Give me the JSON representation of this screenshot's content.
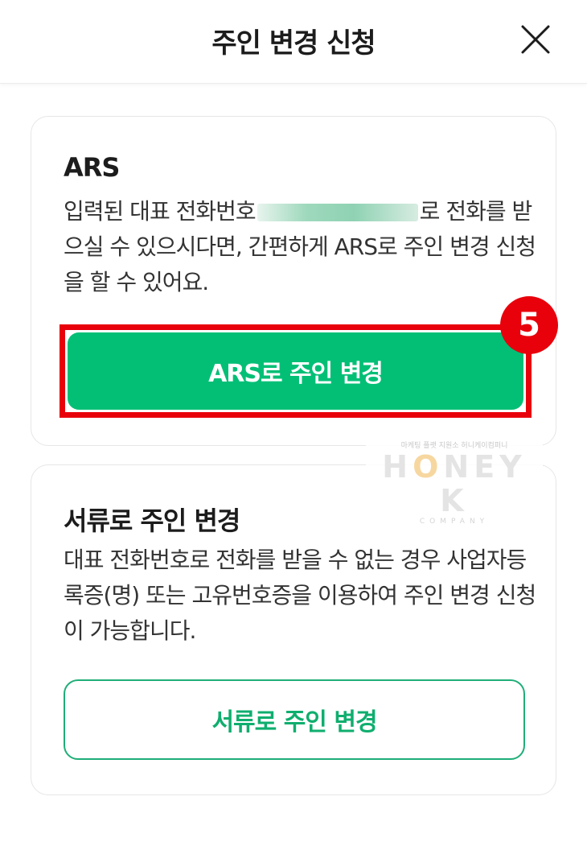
{
  "header": {
    "title": "주인 변경 신청",
    "close_icon": "close-icon"
  },
  "ars_card": {
    "title": "ARS",
    "description_before": "입력된 대표 전화번호",
    "description_after": "로 전화를 받으실 수 있으시다면, 간편하게 ARS로 주인 변경 신청을 할 수 있어요.",
    "button_label": "ARS로 주인 변경",
    "step_badge": "5",
    "highlight_color": "#e8000b",
    "button_color": "#03bf76"
  },
  "doc_card": {
    "title": "서류로 주인 변경",
    "description": "대표 전화번호로 전화를 받을 수 없는 경우 사업자등록증(명) 또는 고유번호증을 이용하여 주인 변경 신청이 가능합니다.",
    "button_label": "서류로 주인 변경"
  },
  "watermark": {
    "tagline": "마케팅 플랫 지원소 허니케이컴퍼니",
    "brand_left": "H",
    "brand_accent": "O",
    "brand_right": "NEY K",
    "brand_sub": "COMPANY"
  }
}
